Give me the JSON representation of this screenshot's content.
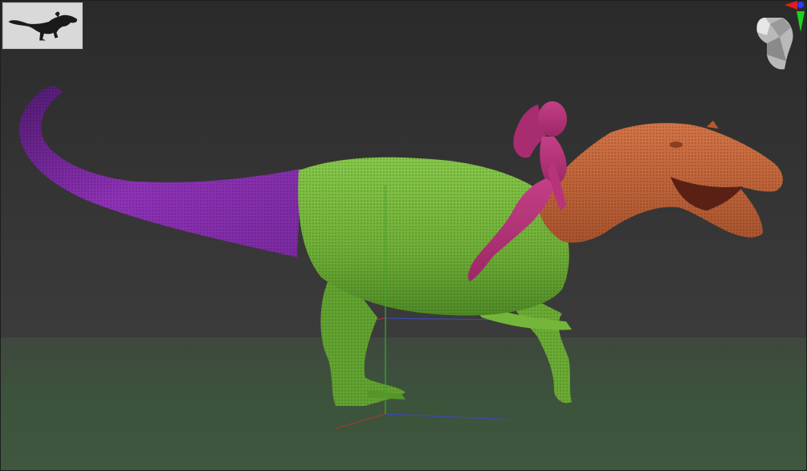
{
  "viewport": {
    "background_top": "#2a2a2a",
    "background_bottom": "#3c3c3c",
    "floor_color": "#3e5c3e"
  },
  "thumbnail": {
    "icon": "dinosaur-silhouette-icon",
    "background": "#d9d9d9",
    "silhouette_color": "#1a1a1a"
  },
  "navigation_widget": {
    "icon": "head-navigation-icon",
    "axis_colors": {
      "x": "#e21d1d",
      "y": "#1fd11f",
      "z": "#2b3bff"
    }
  },
  "model": {
    "tail_color": "#8e32b6",
    "body_color": "#74b63a",
    "neck_head_color": "#c0643a",
    "rider_color": "#b8337a"
  },
  "gizmo": {
    "x_color": "#9b3b2e",
    "y_color": "#2fb02f",
    "z_color": "#3a4ab0"
  }
}
